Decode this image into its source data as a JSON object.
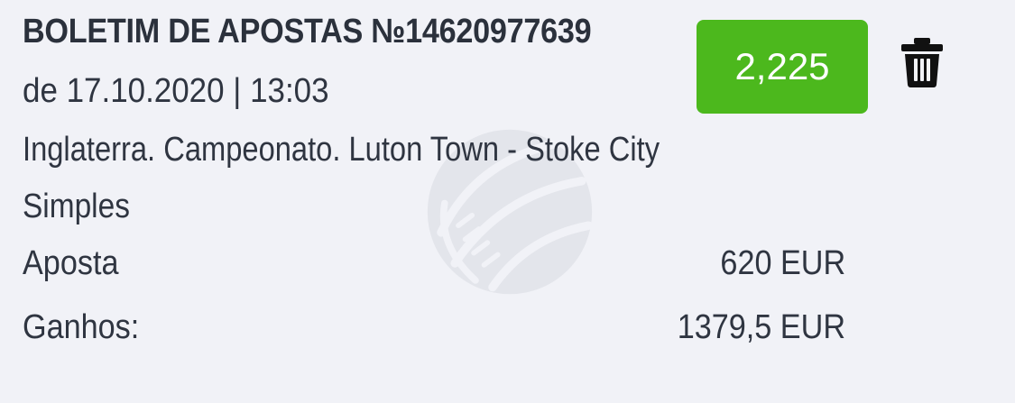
{
  "coupon": {
    "title": "BOLETIM DE APOSTAS №14620977639",
    "date_line": "de 17.10.2020 | 13:03",
    "event": "Inglaterra. Campeonato. Luton Town - Stoke City",
    "bet_type": "Simples",
    "odds": "2,225",
    "stake_label": "Aposta",
    "stake_value": "620 EUR",
    "winnings_label": "Ganhos:",
    "winnings_value": "1379,5 EUR"
  },
  "icons": {
    "delete": "trash-icon",
    "watermark": "ball-watermark-icon"
  },
  "colors": {
    "background": "#f1f2f7",
    "odds_badge": "#4cb81d",
    "text": "#2f3541"
  }
}
